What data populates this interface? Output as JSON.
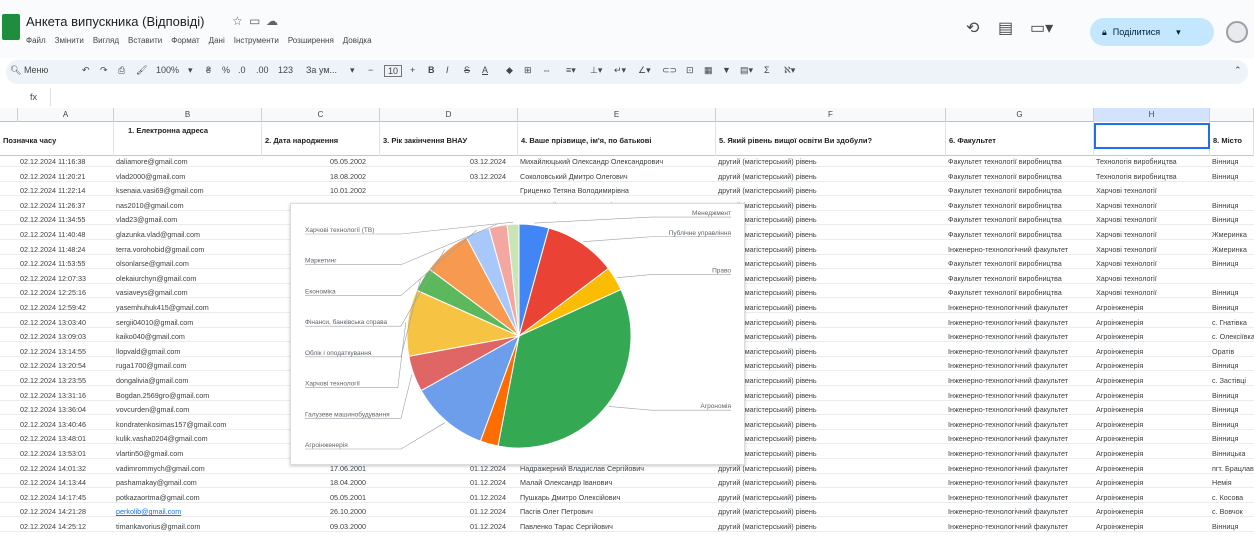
{
  "header": {
    "doc_title": "Анкета випускника (Відповіді)",
    "menu": [
      "Файл",
      "Змінити",
      "Вигляд",
      "Вставити",
      "Формат",
      "Дані",
      "Інструменти",
      "Розширення",
      "Довідка"
    ],
    "share_label": "Поділитися"
  },
  "toolbar": {
    "menus": "Меню",
    "zoom": "100%",
    "font": "За ум...",
    "font_size": "10",
    "number_format": "123"
  },
  "formula_bar": {
    "name_box": "H1",
    "fx": "fx"
  },
  "columns": [
    "A",
    "B",
    "C",
    "D",
    "E",
    "F",
    "G",
    "H"
  ],
  "table": {
    "headers": [
      "Позначка часу",
      "1. Електронна адреса",
      "2. Дата народження",
      "3. Рік закінчення ВНАУ",
      "4. Ваше прізвище, ім'я, по батькові",
      "5. Який рівень вищої освіти Ви здобули?",
      "6. Факультет",
      "",
      "8. Місто"
    ],
    "rows": [
      [
        "02.12.2024 11:16:38",
        "daliamore@gmail.com",
        "05.05.2002",
        "03.12.2024",
        "Михайлюцький Олександр Олександрович",
        "другий (магістерський) рівень",
        "Факультет технології виробництва",
        "Технологія виробництва",
        "Вінниця"
      ],
      [
        "02.12.2024 11:20:21",
        "vlad2000@gmail.com",
        "18.08.2002",
        "03.12.2024",
        "Соколовський Дмитро Олегович",
        "другий (магістерський) рівень",
        "Факультет технології виробництва",
        "Технологія виробництва",
        "Вінниця"
      ],
      [
        "02.12.2024 11:22:14",
        "ksenaia.vasi69@gmail.com",
        "10.01.2002",
        "",
        "Гриценко Тетяна Володимирівна",
        "другий (магістерський) рівень",
        "Факультет технології виробництва",
        "Харчові технології",
        ""
      ],
      [
        "02.12.2024 11:26:37",
        "nas2010@gmail.com",
        "08.10.1995",
        "05.12.2024",
        "Вознюцкий Марьяна Олексіївна",
        "другий (магістерський) рівень",
        "Факультет технології виробництва",
        "Харчові технології",
        "Вінниця"
      ],
      [
        "02.12.2024 11:34:55",
        "vlad23@gmail.com",
        "",
        "",
        "",
        "другий (магістерський) рівень",
        "Факультет технології виробництва",
        "Харчові технології",
        "Вінниця"
      ],
      [
        "02.12.2024 11:40:48",
        "glazunka.vlad@gmail.com",
        "",
        "",
        "",
        "другий (магістерський) рівень",
        "Факультет технології виробництва",
        "Харчові технології",
        "Жмеринка"
      ],
      [
        "02.12.2024 11:48:24",
        "terra.vorohobid@gmail.com",
        "",
        "",
        "",
        "другий (магістерський) рівень",
        "Інженерно-технологічний факультет",
        "Харчові технології",
        "Жмеринка"
      ],
      [
        "02.12.2024 11:53:55",
        "olsonlarse@gmail.com",
        "",
        "",
        "",
        "другий (магістерський) рівень",
        "Факультет технології виробництва",
        "Харчові технології",
        "Вінниця"
      ],
      [
        "02.12.2024 12:07:33",
        "olekaiurchyn@gmail.com",
        "",
        "",
        "",
        "другий (магістерський) рівень",
        "Факультет технології виробництва",
        "Харчові технології",
        ""
      ],
      [
        "02.12.2024 12:25:16",
        "vasiaveys@gmail.com",
        "",
        "",
        "",
        "другий (магістерський) рівень",
        "Факультет технології виробництва",
        "Харчові технології",
        "Вінниця"
      ],
      [
        "02.12.2024 12:59:42",
        "yasemhuhuk415@gmail.com",
        "",
        "",
        "",
        "другий (магістерський) рівень",
        "Інженерно-технологічний факультет",
        "Агроінженерія",
        "Вінниця"
      ],
      [
        "02.12.2024 13:03:40",
        "sergii04010@gmail.com",
        "",
        "",
        "",
        "другий (магістерський) рівень",
        "Інженерно-технологічний факультет",
        "Агроінженерія",
        "с. Гнатівка"
      ],
      [
        "02.12.2024 13:09:03",
        "kaiko040@gmail.com",
        "",
        "",
        "",
        "другий (магістерський) рівень",
        "Інженерно-технологічний факультет",
        "Агроінженерія",
        "с. Олексіївка"
      ],
      [
        "02.12.2024 13:14:55",
        "llopvald@gmail.com",
        "",
        "",
        "",
        "другий (магістерський) рівень",
        "Інженерно-технологічний факультет",
        "Агроінженерія",
        "Оратів"
      ],
      [
        "02.12.2024 13:20:54",
        "ruga1700@gmail.com",
        "",
        "",
        "",
        "другий (магістерський) рівень",
        "Інженерно-технологічний факультет",
        "Агроінженерія",
        "Вінниця"
      ],
      [
        "02.12.2024 13:23:55",
        "dongalivia@gmail.com",
        "",
        "",
        "",
        "другий (магістерський) рівень",
        "Інженерно-технологічний факультет",
        "Агроінженерія",
        "с. Застівці"
      ],
      [
        "02.12.2024 13:31:16",
        "Bogdan.2569gro@gmail.com",
        "",
        "",
        "",
        "другий (магістерський) рівень",
        "Інженерно-технологічний факультет",
        "Агроінженерія",
        "Вінниця"
      ],
      [
        "02.12.2024 13:36:04",
        "vovcurden@gmail.com",
        "",
        "",
        "",
        "другий (магістерський) рівень",
        "Інженерно-технологічний факультет",
        "Агроінженерія",
        "Вінниця"
      ],
      [
        "02.12.2024 13:40:46",
        "kondratenkosimas157@gmail.com",
        "",
        "",
        "",
        "другий (магістерський) рівень",
        "Інженерно-технологічний факультет",
        "Агроінженерія",
        "Вінниця"
      ],
      [
        "02.12.2024 13:48:01",
        "kulik.vasha0204@gmail.com",
        "",
        "",
        "",
        "другий (магістерський) рівень",
        "Інженерно-технологічний факультет",
        "Агроінженерія",
        "Вінниця"
      ],
      [
        "02.12.2024 13:53:01",
        "vlartin50@gmail.com",
        "",
        "",
        "",
        "другий (магістерський) рівень",
        "Інженерно-технологічний факультет",
        "Агроінженерія",
        "Вінницька"
      ],
      [
        "02.12.2024 14:01:32",
        "vadimrommych@gmail.com",
        "17.06.2001",
        "01.12.2024",
        "Надражерний Владислав Сергійович",
        "другий (магістерський) рівень",
        "Інженерно-технологічний факультет",
        "Агроінженерія",
        "пгт. Брацлав"
      ],
      [
        "02.12.2024 14:13:44",
        "pashamakay@gmail.com",
        "18.04.2000",
        "01.12.2024",
        "Малай Олександр Іванович",
        "другий (магістерський) рівень",
        "Інженерно-технологічний факультет",
        "Агроінженерія",
        "Немія"
      ],
      [
        "02.12.2024 14:17:45",
        "potkazaortma@gmail.com",
        "05.05.2001",
        "01.12.2024",
        "Пушкарь Дмитро Олексійович",
        "другий (магістерський) рівень",
        "Інженерно-технологічний факультет",
        "Агроінженерія",
        "с. Косова"
      ],
      [
        "02.12.2024 14:21:28",
        "perkolib@gmail.com",
        "26.10.2000",
        "01.12.2024",
        "Пасгів Олег Петрович",
        "другий (магістерський) рівень",
        "Інженерно-технологічний факультет",
        "Агроінженерія",
        "с. Вовчок"
      ],
      [
        "02.12.2024 14:25:12",
        "timankavorius@gmail.com",
        "09.03.2000",
        "01.12.2024",
        "Павленко Тарас Сергійович",
        "другий (магістерський) рівень",
        "Інженерно-технологічний факультет",
        "Агроінженерія",
        "Вінниця"
      ]
    ]
  },
  "chart_data": {
    "type": "pie",
    "title": "",
    "slices": [
      {
        "label": "Менеджмент",
        "value": 4.3,
        "color": "#4285f4"
      },
      {
        "label": "Публічне управління",
        "value": 10.4,
        "color": "#ea4335"
      },
      {
        "label": "Право",
        "value": 3.5,
        "color": "#fbbc04"
      },
      {
        "label": "Агрономія",
        "value": 34.8,
        "color": "#34a853"
      },
      {
        "label": "",
        "value": 2.6,
        "color": "#ff6d01"
      },
      {
        "label": "Агроінженерія",
        "value": 11.3,
        "color": "#6d9eeb"
      },
      {
        "label": "Галузеве машинобудування",
        "value": 5.2,
        "color": "#e06666"
      },
      {
        "label": "Харчові технології",
        "value": 9.6,
        "color": "#f6c342"
      },
      {
        "label": "Облік і оподаткування",
        "value": 3.5,
        "color": "#5cb85c"
      },
      {
        "label": "Фінанси, банківська справа",
        "value": 7.0,
        "color": "#f79a4f"
      },
      {
        "label": "Економіка",
        "value": 3.5,
        "color": "#a8c7fa"
      },
      {
        "label": "Маркетинг",
        "value": 2.6,
        "color": "#f4a7a0"
      },
      {
        "label": "Харчові технології (ТВ)",
        "value": 1.7,
        "color": "#c9e4b5"
      }
    ],
    "legend": "labels"
  }
}
